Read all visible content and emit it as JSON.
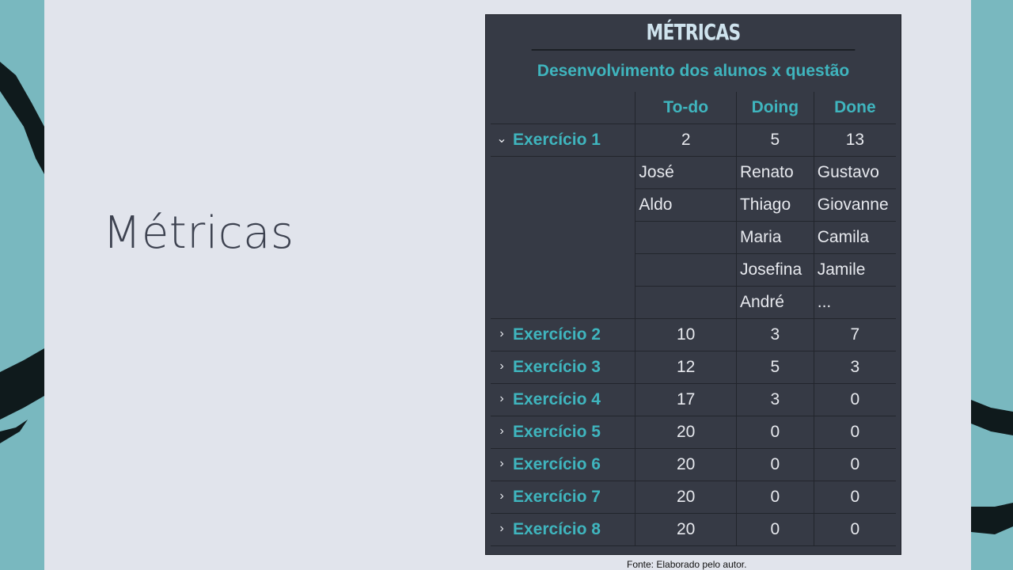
{
  "slide": {
    "title": "Métricas",
    "source_note": "Fonte: Elaborado pelo autor."
  },
  "panel": {
    "header": "MÉTRICAS",
    "subtitle": "Desenvolvimento dos alunos x questão",
    "columns": [
      "To-do",
      "Doing",
      "Done"
    ],
    "expanded": {
      "label": "Exercício 1",
      "todo": "2",
      "doing": "5",
      "done": "13",
      "names": [
        [
          "José",
          "Renato",
          "Gustavo"
        ],
        [
          "Aldo",
          "Thiago",
          "Giovanne"
        ],
        [
          "",
          "Maria",
          "Camila"
        ],
        [
          "",
          "Josefina",
          "Jamile"
        ],
        [
          "",
          "André",
          "..."
        ]
      ]
    },
    "rows": [
      {
        "label": "Exercício 2",
        "todo": "10",
        "doing": "3",
        "done": "7"
      },
      {
        "label": "Exercício 3",
        "todo": "12",
        "doing": "5",
        "done": "3"
      },
      {
        "label": "Exercício 4",
        "todo": "17",
        "doing": "3",
        "done": "0"
      },
      {
        "label": "Exercício 5",
        "todo": "20",
        "doing": "0",
        "done": "0"
      },
      {
        "label": "Exercício 6",
        "todo": "20",
        "doing": "0",
        "done": "0"
      },
      {
        "label": "Exercício 7",
        "todo": "20",
        "doing": "0",
        "done": "0"
      },
      {
        "label": "Exercício 8",
        "todo": "20",
        "doing": "0",
        "done": "0"
      }
    ]
  },
  "colors": {
    "background_teal": "#79b8bf",
    "slide_bg": "#e1e4ec",
    "panel_bg": "#363a45",
    "accent": "#3fb5be"
  },
  "icons": {
    "expanded": "chevron-down-icon",
    "collapsed": "chevron-right-icon"
  }
}
